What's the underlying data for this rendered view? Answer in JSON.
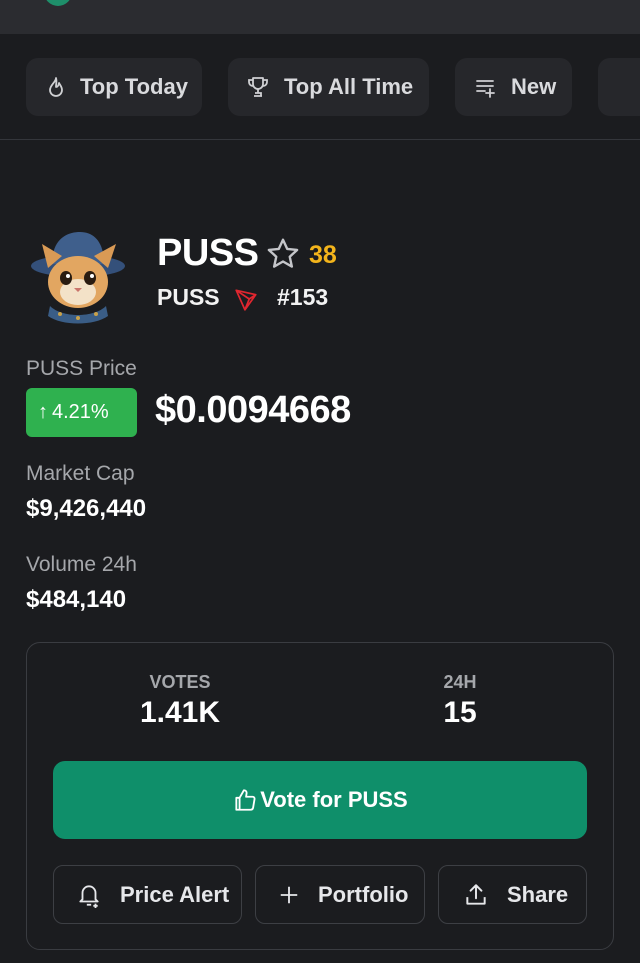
{
  "tabs": [
    {
      "label": "Top Today",
      "icon": "flame-icon"
    },
    {
      "label": "Top All Time",
      "icon": "trophy-icon"
    },
    {
      "label": "New",
      "icon": "list-add-icon"
    }
  ],
  "token": {
    "name": "PUSS",
    "ticker": "PUSS",
    "chain_icon": "tron-icon",
    "rank": "#153",
    "watch_count": "38",
    "price_label": "PUSS Price",
    "change": "4.21%",
    "price": "$0.0094668",
    "market_cap_label": "Market Cap",
    "market_cap": "$9,426,440",
    "volume_label": "Volume 24h",
    "volume": "$484,140"
  },
  "votes": {
    "votes_label": "VOTES",
    "votes_value": "1.41K",
    "h24_label": "24H",
    "h24_value": "15",
    "vote_button": "Vote for PUSS"
  },
  "actions": {
    "alert": "Price Alert",
    "portfolio": "Portfolio",
    "share": "Share"
  },
  "colors": {
    "background": "#1b1c1f",
    "accent_green": "#0f8f6a",
    "change_green": "#2fb14f",
    "star_count": "#f3b41b",
    "tron_red": "#e0262f"
  }
}
